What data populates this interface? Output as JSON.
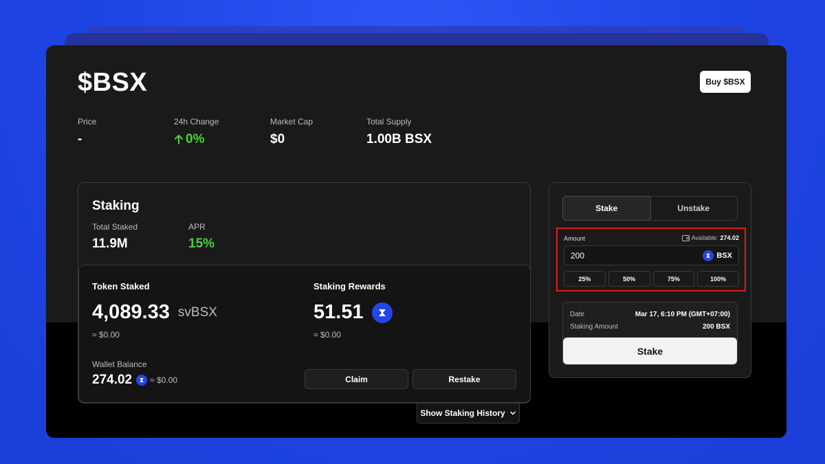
{
  "header": {
    "token_title": "$BSX",
    "buy_label": "Buy $BSX"
  },
  "market_stats": [
    {
      "label": "Price",
      "value": "-"
    },
    {
      "label": "24h Change",
      "value": "0%",
      "direction": "up"
    },
    {
      "label": "Market Cap",
      "value": "$0"
    },
    {
      "label": "Total Supply",
      "value": "1.00B BSX"
    }
  ],
  "staking": {
    "title": "Staking",
    "total_staked_label": "Total Staked",
    "total_staked_value": "11.9M",
    "apr_label": "APR",
    "apr_value": "15%"
  },
  "position": {
    "token_staked_label": "Token Staked",
    "token_staked_value": "4,089.33",
    "token_staked_unit": "svBSX",
    "token_staked_usd": "≈ $0.00",
    "rewards_label": "Staking Rewards",
    "rewards_value": "51.51",
    "rewards_usd": "≈ $0.00",
    "wallet_label": "Wallet Balance",
    "wallet_value": "274.02",
    "wallet_usd": "≈ $0.00",
    "claim_label": "Claim",
    "restake_label": "Restake",
    "history_label": "Show Staking History"
  },
  "stake_form": {
    "tabs": [
      {
        "label": "Stake",
        "active": true
      },
      {
        "label": "Unstake",
        "active": false
      }
    ],
    "amount_label": "Amount",
    "available_label": "Available:",
    "available_value": "274.02",
    "amount_value": "200",
    "token": "BSX",
    "percent_options": [
      "25%",
      "50%",
      "75%",
      "100%"
    ],
    "date_label": "Date",
    "date_value": "Mar 17, 6:10 PM (GMT+07:00)",
    "staking_amount_label": "Staking Amount",
    "staking_amount_value": "200 BSX",
    "submit_label": "Stake"
  },
  "colors": {
    "background": "#1f45e6",
    "card": "#1a1a1a",
    "positive": "#4cd13a",
    "highlight_border": "#e01b1b",
    "token_accent": "#2546e6"
  },
  "icons": {
    "change_direction": "arrow-up-icon",
    "token": "bsx-token-icon",
    "wallet": "wallet-icon",
    "expand": "chevron-down-icon"
  }
}
